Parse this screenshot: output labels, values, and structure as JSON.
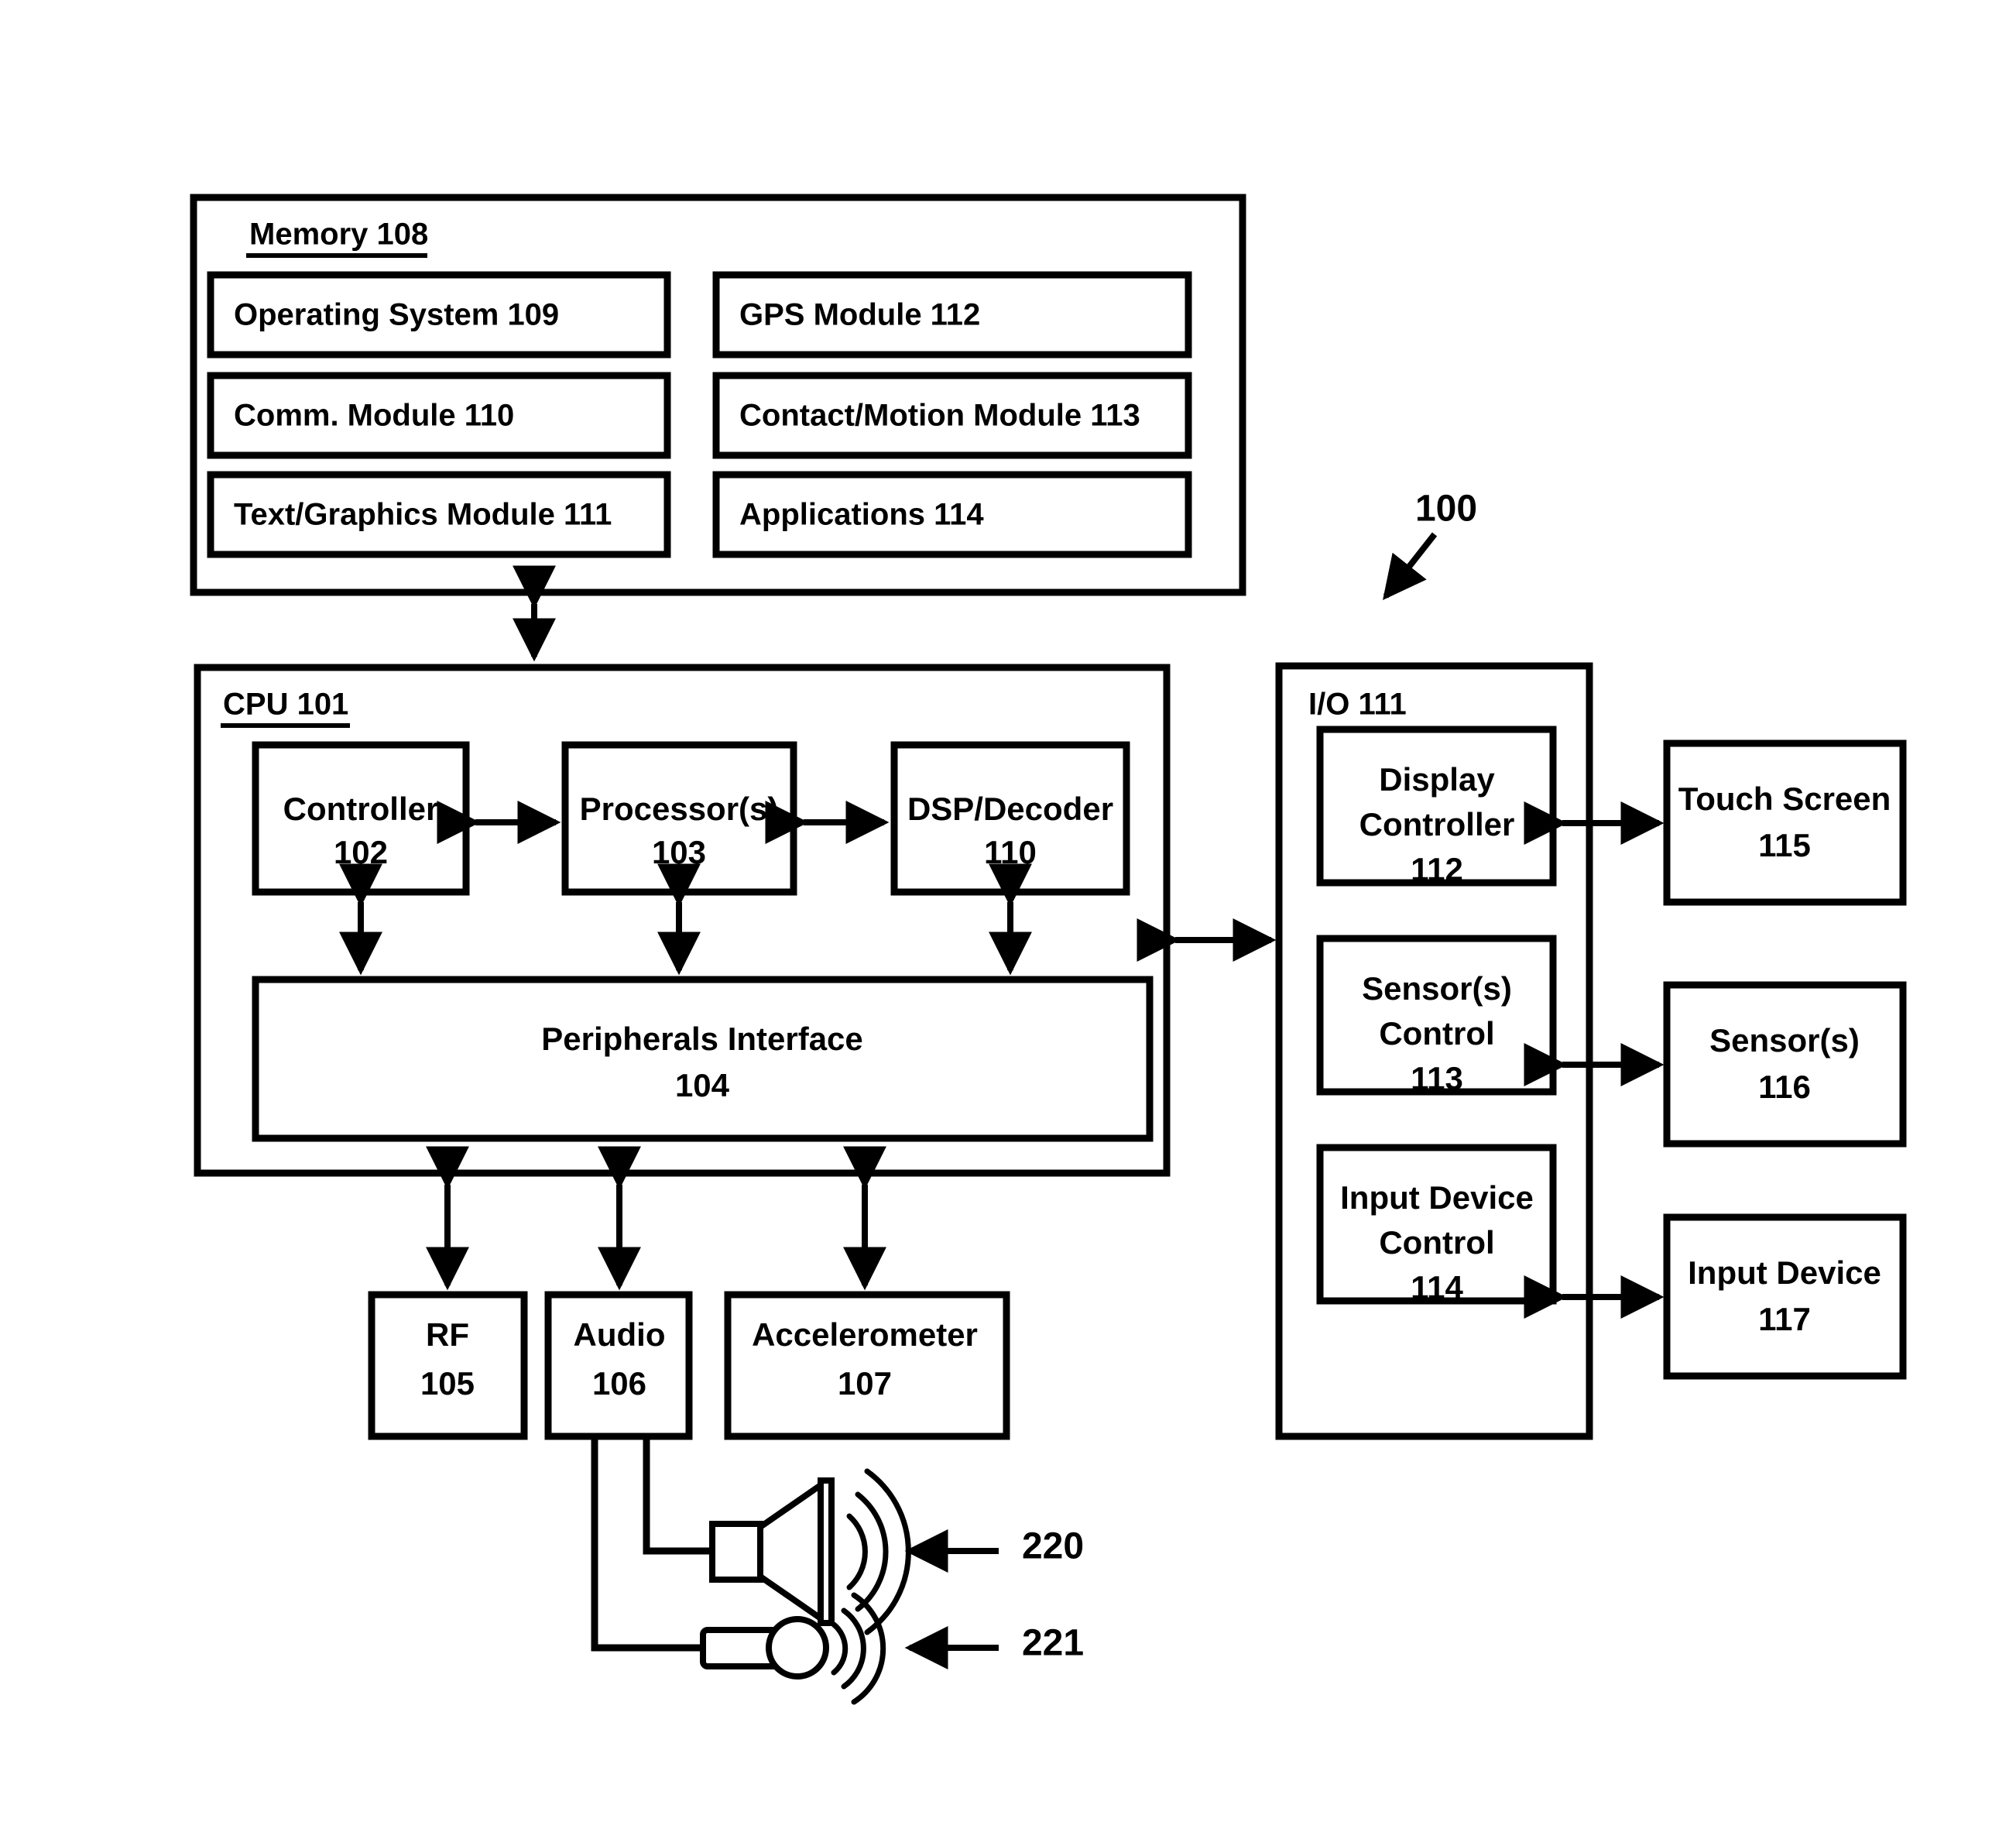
{
  "figure": {
    "reference_numeral": "100",
    "memory": {
      "title": "Memory 108",
      "modules_left": [
        {
          "label": "Operating System 109"
        },
        {
          "label": "Comm. Module 110"
        },
        {
          "label": "Text/Graphics Module 111"
        }
      ],
      "modules_right": [
        {
          "label": "GPS Module 112"
        },
        {
          "label": "Contact/Motion Module 113"
        },
        {
          "label": "Applications 114"
        }
      ]
    },
    "cpu": {
      "title": "CPU 101",
      "blocks": [
        {
          "line1": "Controller",
          "line2": "102"
        },
        {
          "line1": "Processor(s)",
          "line2": "103"
        },
        {
          "line1": "DSP/Decoder",
          "line2": "110"
        }
      ],
      "peripherals_interface": {
        "line1": "Peripherals Interface",
        "line2": "104"
      }
    },
    "io": {
      "title": "I/O 111",
      "controls": [
        {
          "line1": "Display",
          "line2": "Controller",
          "line3": "112"
        },
        {
          "line1": "Sensor(s)",
          "line2": "Control",
          "line3": "113"
        },
        {
          "line1": "Input Device",
          "line2": "Control",
          "line3": "114"
        }
      ],
      "devices": [
        {
          "line1": "Touch Screen",
          "line2": "115"
        },
        {
          "line1": "Sensor(s)",
          "line2": "116"
        },
        {
          "line1": "Input Device",
          "line2": "117"
        }
      ]
    },
    "peripherals": [
      {
        "line1": "RF",
        "line2": "105"
      },
      {
        "line1": "Audio",
        "line2": "106"
      },
      {
        "line1": "Accelerometer",
        "line2": "107"
      }
    ],
    "audio_devices": [
      {
        "icon": "speaker-icon",
        "reference": "220"
      },
      {
        "icon": "microphone-icon",
        "reference": "221"
      }
    ]
  }
}
